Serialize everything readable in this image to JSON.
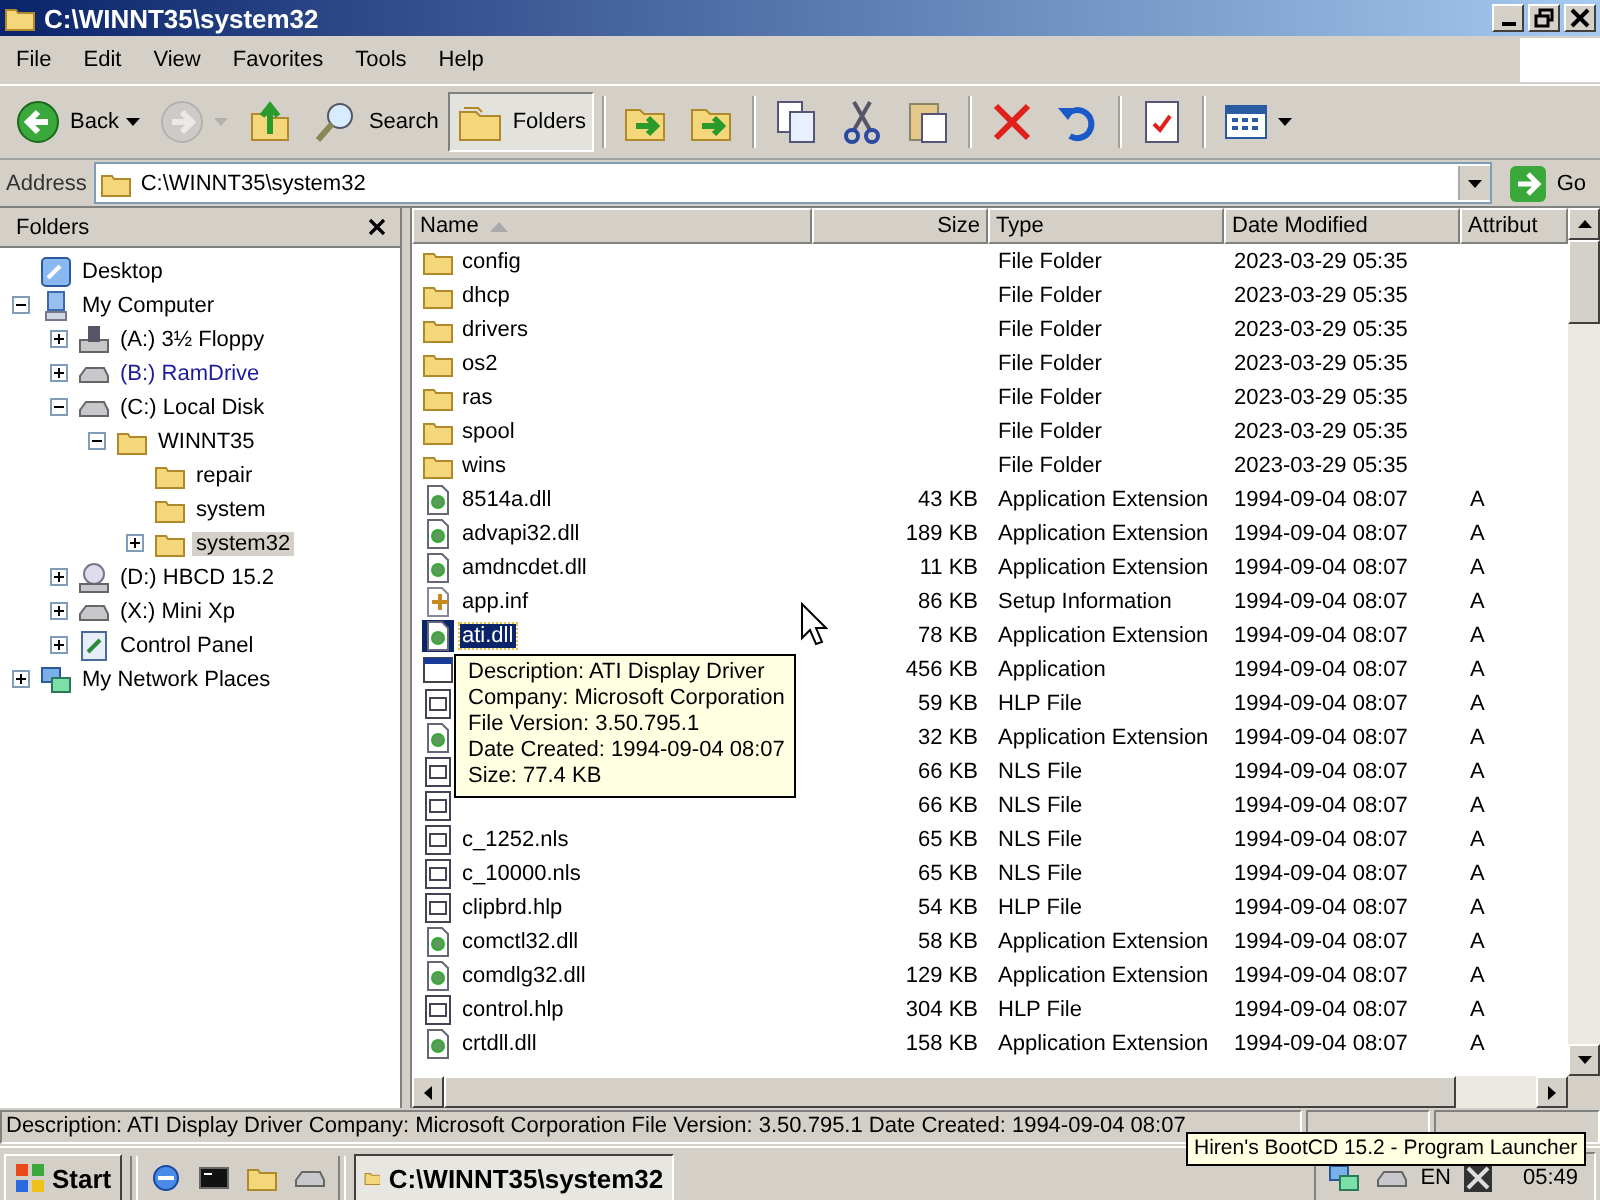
{
  "window": {
    "title": "C:\\WINNT35\\system32"
  },
  "menu": [
    "File",
    "Edit",
    "View",
    "Favorites",
    "Tools",
    "Help"
  ],
  "toolbar": [
    {
      "kind": "back",
      "label": "Back",
      "dropdown": true,
      "disabled": false,
      "on": false
    },
    {
      "kind": "forward",
      "dropdown": true,
      "disabled": true,
      "on": false
    },
    {
      "kind": "up",
      "disabled": false,
      "on": false
    },
    {
      "kind": "search",
      "label": "Search",
      "disabled": false,
      "on": false
    },
    {
      "kind": "folders",
      "label": "Folders",
      "disabled": false,
      "on": true
    },
    {
      "kind": "move",
      "disabled": false,
      "on": false
    },
    {
      "kind": "copyto",
      "disabled": false,
      "on": false
    },
    {
      "kind": "copy",
      "disabled": false,
      "on": false
    },
    {
      "kind": "cut",
      "disabled": false,
      "on": false
    },
    {
      "kind": "paste",
      "disabled": false,
      "on": false
    },
    {
      "kind": "delete",
      "disabled": false,
      "on": false
    },
    {
      "kind": "undo",
      "disabled": false,
      "on": false
    },
    {
      "kind": "properties",
      "disabled": false,
      "on": false
    },
    {
      "kind": "views",
      "dropdown": true,
      "disabled": false,
      "on": false
    }
  ],
  "address": {
    "label": "Address",
    "value": "C:\\WINNT35\\system32",
    "go": "Go"
  },
  "folders_pane": {
    "title": "Folders",
    "tree": [
      {
        "label": "Desktop",
        "kind": "desktop",
        "selected": false
      },
      {
        "label": "My Computer",
        "kind": "computer",
        "expanded": true,
        "selected": false,
        "children": [
          {
            "label": "(A:) 3½ Floppy",
            "kind": "floppy",
            "expanded": false,
            "selected": false
          },
          {
            "label": "(B:) RamDrive",
            "kind": "drive",
            "expanded": false,
            "selected": false,
            "color": "#1c1c9c"
          },
          {
            "label": "(C:) Local Disk",
            "kind": "drive",
            "expanded": true,
            "selected": false,
            "children": [
              {
                "label": "WINNT35",
                "kind": "folder",
                "expanded": true,
                "selected": false,
                "children": [
                  {
                    "label": "repair",
                    "kind": "folder",
                    "selected": false
                  },
                  {
                    "label": "system",
                    "kind": "folder",
                    "selected": false
                  },
                  {
                    "label": "system32",
                    "kind": "folder",
                    "expanded": false,
                    "selected": true
                  }
                ]
              }
            ]
          },
          {
            "label": "(D:) HBCD 15.2",
            "kind": "cdrom",
            "expanded": false,
            "selected": false
          },
          {
            "label": "(X:) Mini Xp",
            "kind": "drive",
            "expanded": false,
            "selected": false
          },
          {
            "label": "Control Panel",
            "kind": "control",
            "expanded": false,
            "selected": false
          }
        ]
      },
      {
        "label": "My Network Places",
        "kind": "network",
        "expanded": false,
        "selected": false
      }
    ]
  },
  "file_list": {
    "columns": [
      {
        "label": "Name",
        "sorted": true
      },
      {
        "label": "Size",
        "sorted": false
      },
      {
        "label": "Type",
        "sorted": false
      },
      {
        "label": "Date Modified",
        "sorted": false
      },
      {
        "label": "Attribut",
        "sorted": false
      }
    ],
    "rows": [
      {
        "kind": "folder",
        "name": "config",
        "type": "File Folder",
        "date": "2023-03-29 05:35",
        "selected": false
      },
      {
        "kind": "folder",
        "name": "dhcp",
        "type": "File Folder",
        "date": "2023-03-29 05:35",
        "selected": false
      },
      {
        "kind": "folder",
        "name": "drivers",
        "type": "File Folder",
        "date": "2023-03-29 05:35",
        "selected": false
      },
      {
        "kind": "folder",
        "name": "os2",
        "type": "File Folder",
        "date": "2023-03-29 05:35",
        "selected": false
      },
      {
        "kind": "folder",
        "name": "ras",
        "type": "File Folder",
        "date": "2023-03-29 05:35",
        "selected": false
      },
      {
        "kind": "folder",
        "name": "spool",
        "type": "File Folder",
        "date": "2023-03-29 05:35",
        "selected": false
      },
      {
        "kind": "folder",
        "name": "wins",
        "type": "File Folder",
        "date": "2023-03-29 05:35",
        "selected": false
      },
      {
        "kind": "dll",
        "name": "8514a.dll",
        "size": "43 KB",
        "type": "Application Extension",
        "date": "1994-09-04 08:07",
        "attributes": "A",
        "selected": false
      },
      {
        "kind": "dll",
        "name": "advapi32.dll",
        "size": "189 KB",
        "type": "Application Extension",
        "date": "1994-09-04 08:07",
        "attributes": "A",
        "selected": false
      },
      {
        "kind": "dll",
        "name": "amdncdet.dll",
        "size": "11 KB",
        "type": "Application Extension",
        "date": "1994-09-04 08:07",
        "attributes": "A",
        "selected": false
      },
      {
        "kind": "inf",
        "name": "app.inf",
        "size": "86 KB",
        "type": "Setup Information",
        "date": "1994-09-04 08:07",
        "attributes": "A",
        "selected": false
      },
      {
        "kind": "dll",
        "name": "ati.dll",
        "size": "78 KB",
        "type": "Application Extension",
        "date": "1994-09-04 08:07",
        "attributes": "A",
        "selected": true
      },
      {
        "kind": "app",
        "size": "456 KB",
        "type": "Application",
        "date": "1994-09-04 08:07",
        "attributes": "A",
        "selected": false
      },
      {
        "kind": "hlp",
        "size": "59 KB",
        "type": "HLP File",
        "date": "1994-09-04 08:07",
        "attributes": "A",
        "selected": false
      },
      {
        "kind": "dll",
        "size": "32 KB",
        "type": "Application Extension",
        "date": "1994-09-04 08:07",
        "attributes": "A",
        "selected": false
      },
      {
        "kind": "hlp",
        "size": "66 KB",
        "type": "NLS File",
        "date": "1994-09-04 08:07",
        "attributes": "A",
        "selected": false
      },
      {
        "kind": "hlp",
        "size": "66 KB",
        "type": "NLS File",
        "date": "1994-09-04 08:07",
        "attributes": "A",
        "selected": false
      },
      {
        "kind": "hlp",
        "name": "c_1252.nls",
        "size": "65 KB",
        "type": "NLS File",
        "date": "1994-09-04 08:07",
        "attributes": "A",
        "selected": false
      },
      {
        "kind": "hlp",
        "name": "c_10000.nls",
        "size": "65 KB",
        "type": "NLS File",
        "date": "1994-09-04 08:07",
        "attributes": "A",
        "selected": false
      },
      {
        "kind": "hlp",
        "name": "clipbrd.hlp",
        "size": "54 KB",
        "type": "HLP File",
        "date": "1994-09-04 08:07",
        "attributes": "A",
        "selected": false
      },
      {
        "kind": "dll",
        "name": "comctl32.dll",
        "size": "58 KB",
        "type": "Application Extension",
        "date": "1994-09-04 08:07",
        "attributes": "A",
        "selected": false
      },
      {
        "kind": "dll",
        "name": "comdlg32.dll",
        "size": "129 KB",
        "type": "Application Extension",
        "date": "1994-09-04 08:07",
        "attributes": "A",
        "selected": false
      },
      {
        "kind": "hlp",
        "name": "control.hlp",
        "size": "304 KB",
        "type": "HLP File",
        "date": "1994-09-04 08:07",
        "attributes": "A",
        "selected": false
      },
      {
        "kind": "dll",
        "name": "crtdll.dll",
        "size": "158 KB",
        "type": "Application Extension",
        "date": "1994-09-04 08:07",
        "attributes": "A",
        "selected": false
      }
    ],
    "tooltip": [
      "Description: ATI Display Driver",
      "Company: Microsoft Corporation",
      "File Version: 3.50.795.1",
      "Date Created: 1994-09-04 08:07",
      "Size: 77.4 KB"
    ]
  },
  "status_bar": {
    "text": "Description: ATI Display Driver Company: Microsoft Corporation File Version: 3.50.795.1 Date Created: 1994-09-04 08:07"
  },
  "taskbar": {
    "start": "Start",
    "quick_launch": [
      {
        "kind": "ie"
      },
      {
        "kind": "cmd"
      },
      {
        "kind": "folder"
      },
      {
        "kind": "drive"
      }
    ],
    "tasks": [
      {
        "label": "C:\\WINNT35\\system32",
        "selected": true
      }
    ],
    "tray": {
      "icons": [
        {
          "kind": "network"
        },
        {
          "kind": "drive"
        }
      ],
      "language": "EN",
      "tool": {
        "kind": "tools"
      },
      "clock": "05:49"
    },
    "tooltip": "Hiren's BootCD 15.2 - Program Launcher"
  }
}
